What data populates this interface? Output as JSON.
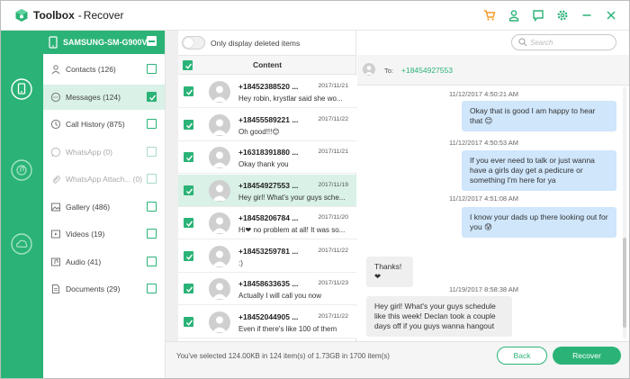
{
  "app": {
    "brand": "Toolbox",
    "separator": "-",
    "mode": "Recover"
  },
  "colors": {
    "accent": "#2bb377",
    "selected_row": "#d9f1e6",
    "outgoing_bubble": "#cfe6fb",
    "incoming_bubble": "#efefef"
  },
  "titlebar_icons": [
    "cart-icon",
    "user-icon",
    "feedback-icon",
    "settings-icon",
    "minimize-icon",
    "close-icon"
  ],
  "rail": [
    "phone-restore-icon",
    "itunes-restore-icon",
    "icloud-restore-icon"
  ],
  "device": {
    "name": "SAMSUNG-SM-G900V"
  },
  "categories": [
    {
      "label": "Contacts (126)",
      "icon": "contacts-icon",
      "checked": false,
      "enabled": true
    },
    {
      "label": "Messages (124)",
      "icon": "messages-icon",
      "checked": true,
      "enabled": true,
      "active": true
    },
    {
      "label": "Call History (875)",
      "icon": "call-history-icon",
      "checked": false,
      "enabled": true
    },
    {
      "label": "WhatsApp (0)",
      "icon": "whatsapp-icon",
      "checked": false,
      "enabled": false
    },
    {
      "label": "WhatsApp Attach...  (0)",
      "icon": "attachment-icon",
      "checked": false,
      "enabled": false
    },
    {
      "label": "Gallery (486)",
      "icon": "gallery-icon",
      "checked": false,
      "enabled": true
    },
    {
      "label": "Videos (19)",
      "icon": "videos-icon",
      "checked": false,
      "enabled": true
    },
    {
      "label": "Audio (41)",
      "icon": "audio-icon",
      "checked": false,
      "enabled": true
    },
    {
      "label": "Documents (29)",
      "icon": "documents-icon",
      "checked": false,
      "enabled": true
    }
  ],
  "filter": {
    "label": "Only display deleted items",
    "on": false
  },
  "search": {
    "placeholder": "Search",
    "value": ""
  },
  "list": {
    "header": "Content",
    "rows": [
      {
        "number": "+18452388520 ...",
        "date": "2017/11/21",
        "snippet": "Hey robin, krystlar said she wo...",
        "checked": true
      },
      {
        "number": "+18455589221 ...",
        "date": "2017/11/22",
        "snippet": "Oh good!!!😊",
        "checked": true
      },
      {
        "number": "+16318391880 ...",
        "date": "2017/11/21",
        "snippet": "Okay thank you",
        "checked": true
      },
      {
        "number": "+18454927553 ...",
        "date": "2017/11/19",
        "snippet": "Hey girl! What's your guys sche...",
        "checked": true,
        "selected": true
      },
      {
        "number": "+18458206784 ...",
        "date": "2017/11/20",
        "snippet": "Hi❤ no problem at all! It was so...",
        "checked": true
      },
      {
        "number": "+18453259781 ...",
        "date": "2017/11/22",
        "snippet": ":)",
        "checked": true
      },
      {
        "number": "+18458633635 ...",
        "date": "2017/11/23",
        "snippet": "Actually I will call you now",
        "checked": true
      },
      {
        "number": "+18452044905 ...",
        "date": "2017/11/22",
        "snippet": "Even if there's like 100 of them",
        "checked": true
      }
    ]
  },
  "chat": {
    "to_label": "To:",
    "to_number": "+18454927553",
    "messages": [
      {
        "kind": "time",
        "text": "11/12/2017 4:50:21 AM"
      },
      {
        "kind": "out",
        "text": "Okay that is good I am happy to hear that 😊"
      },
      {
        "kind": "time",
        "text": "11/12/2017 4:50:53 AM"
      },
      {
        "kind": "out",
        "text": "If you ever need to talk or just wanna have a girls day get a pedicure or something I'm here for ya"
      },
      {
        "kind": "time",
        "text": "11/12/2017 4:51:08 AM"
      },
      {
        "kind": "out",
        "text": "I know your dads up there looking out for you 😰"
      },
      {
        "kind": "in",
        "text": "Thanks!❤"
      },
      {
        "kind": "time",
        "text": "11/19/2017 8:58:38 AM"
      },
      {
        "kind": "in",
        "text": "Hey girl! What's your guys schedule like this week! Declan took a couple days off if you guys wanna hangout"
      }
    ]
  },
  "footer": {
    "info": "You've selected 124.00KB in 124 item(s) of 1.73GB in 1700 item(s)",
    "back_label": "Back",
    "recover_label": "Recover"
  }
}
